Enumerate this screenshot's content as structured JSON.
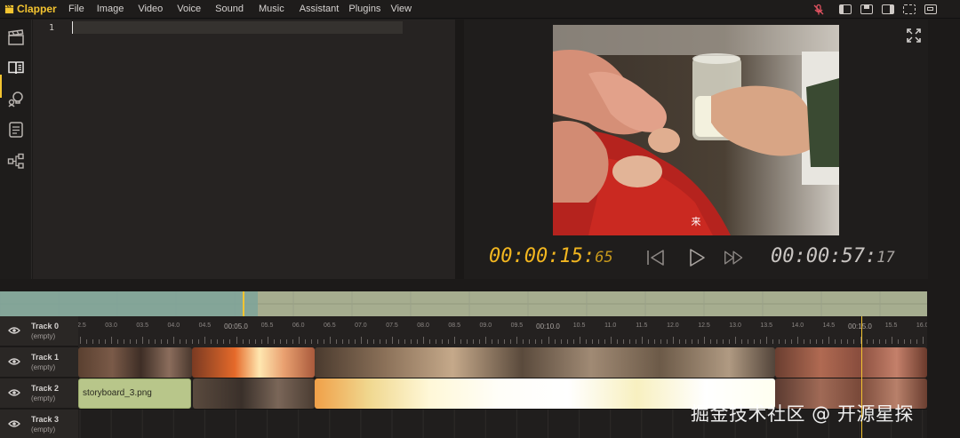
{
  "app": {
    "name": "Clapper"
  },
  "menu": [
    "File",
    "Image",
    "Video",
    "Voice",
    "Sound",
    "Music",
    "Assistant",
    "Plugins",
    "View"
  ],
  "icons": {
    "logo": "clapperboard-icon",
    "mic": "microphone-muted-icon",
    "layouts": [
      "layout-left-icon",
      "layout-top-icon",
      "layout-right-icon",
      "layout-focus-icon",
      "layout-full-icon"
    ],
    "sidebar": [
      "clapperboard-icon",
      "book-icon",
      "bulb-icon",
      "list-icon",
      "nodes-icon"
    ]
  },
  "colors": {
    "accent": "#f4c430",
    "mic_muted": "#e05260"
  },
  "editor": {
    "line_number": "1"
  },
  "player": {
    "subtitle": "来",
    "current_time_main": "00:00:15:",
    "current_time_frames": "65",
    "total_time_main": "00:00:57:",
    "total_time_frames": "17"
  },
  "ruler": {
    "labels": [
      "02.5",
      "03.0",
      "03.5",
      "04.0",
      "04.5",
      "00:05.0",
      "05.5",
      "06.0",
      "06.5",
      "07.0",
      "07.5",
      "08.0",
      "08.5",
      "09.0",
      "09.5",
      "00:10.0",
      "10.5",
      "11.0",
      "11.5",
      "12.0",
      "12.5",
      "13.0",
      "13.5",
      "14.0",
      "14.5",
      "00:15.0",
      "15.5",
      "16.0"
    ]
  },
  "tracks": [
    {
      "name": "Track 0",
      "sub": "(empty)"
    },
    {
      "name": "Track 1",
      "sub": "(empty)"
    },
    {
      "name": "Track 2",
      "sub": "(empty)"
    },
    {
      "name": "Track 3",
      "sub": "(empty)"
    }
  ],
  "clips": {
    "storyboard_label": "storyboard_3.png"
  },
  "watermark": "掘金技术社区 @ 开源星探"
}
